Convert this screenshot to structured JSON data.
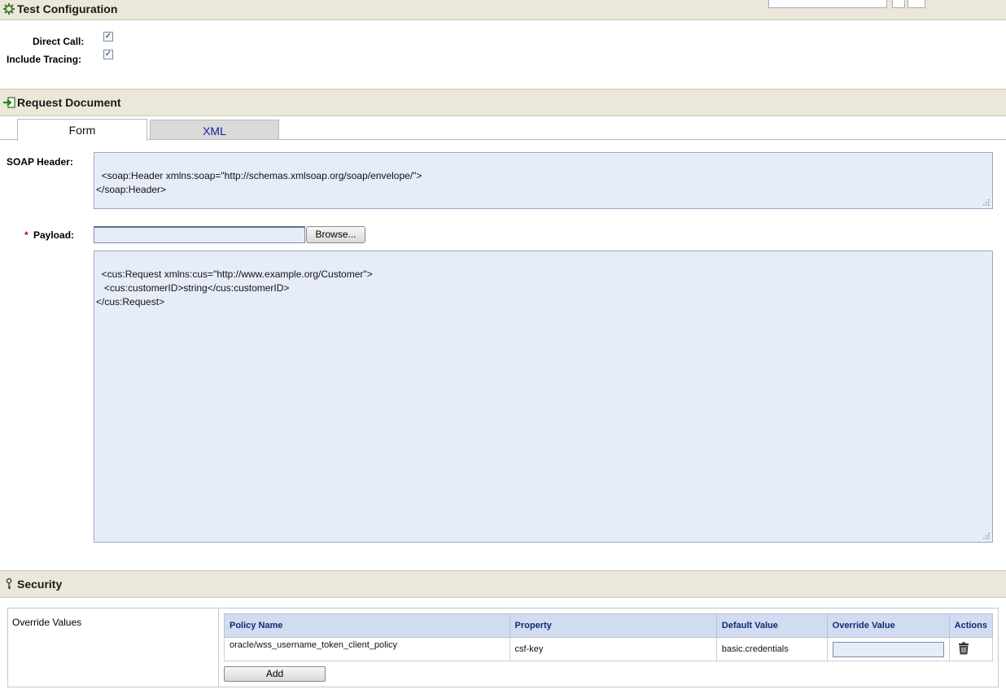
{
  "test_config": {
    "title": "Test Configuration",
    "direct_call_label": "Direct Call:",
    "include_tracing_label": "Include Tracing:",
    "direct_call_checked": true,
    "include_tracing_checked": true
  },
  "request_document": {
    "title": "Request Document",
    "tabs": [
      {
        "label": "Form",
        "active": true
      },
      {
        "label": "XML",
        "active": false
      }
    ],
    "soap_header_label": "SOAP Header:",
    "soap_header_value": "<soap:Header xmlns:soap=\"http://schemas.xmlsoap.org/soap/envelope/\">\n</soap:Header>",
    "payload_required_marker": "*",
    "payload_label": "Payload:",
    "browse_label": "Browse...",
    "payload_value": "<cus:Request xmlns:cus=\"http://www.example.org/Customer\">\n   <cus:customerID>string</cus:customerID>\n</cus:Request>"
  },
  "security": {
    "title": "Security",
    "override_values_label": "Override Values",
    "columns": [
      "Policy Name",
      "Property",
      "Default Value",
      "Override Value",
      "Actions"
    ],
    "rows": [
      {
        "policy_name": "oracle/wss_username_token_client_policy",
        "property": "csf-key",
        "default_value": "basic.credentials",
        "override_value": ""
      }
    ],
    "add_label": "Add"
  },
  "colors": {
    "section_header_bg": "#ebe7d9",
    "textarea_bg": "#e6edf9",
    "table_header_bg": "#d2dcf0",
    "table_header_text": "#0b2d74",
    "tab_inactive_bg": "#d9d9d9",
    "tab_inactive_text": "#1a1aa6",
    "required_marker": "#cc0000"
  }
}
